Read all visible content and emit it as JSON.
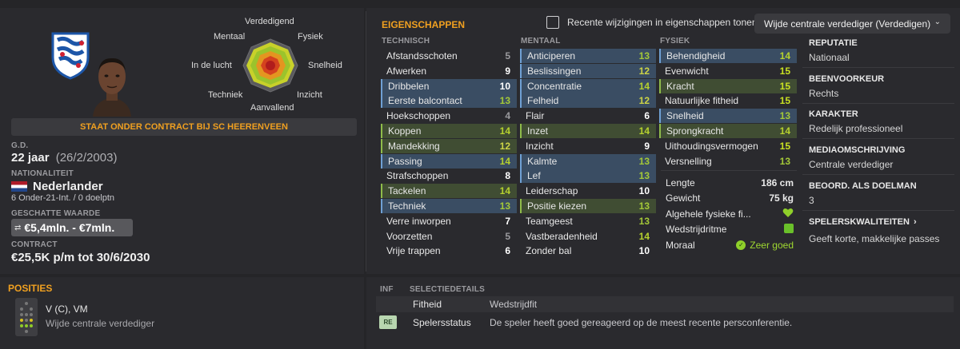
{
  "profile": {
    "contract_banner": "STAAT ONDER CONTRACT BIJ SC HEERENVEEN",
    "dob_label": "G.D.",
    "age": "22 jaar",
    "dob": "(26/2/2003)",
    "nationality_label": "NATIONALITEIT",
    "nationality": "Nederlander",
    "caps": "6 Onder-21-Int. / 0 doelptn",
    "value_label": "GESCHATTE WAARDE",
    "value": "€5,4mln. - €7mln.",
    "contract_label": "CONTRACT",
    "contract": "€25,5K p/m tot 30/6/2030",
    "club_logo_text": "sc Heerenveen"
  },
  "radar": {
    "labels": {
      "top": "Verdedigend",
      "top_left": "Mentaal",
      "top_right": "Fysiek",
      "left": "In de lucht",
      "right": "Snelheid",
      "bottom_left": "Techniek",
      "bottom_right": "Inzicht",
      "bottom": "Aanvallend"
    }
  },
  "attributes": {
    "title": "EIGENSCHAPPEN",
    "toggle_label": "Recente wijzigingen in eigenschappen tonen",
    "role_select": "Wijde centrale verdediger (Verdedigen)",
    "technical_header": "TECHNISCH",
    "mental_header": "MENTAAL",
    "physical_header": "FYSIEK",
    "technical": [
      {
        "name": "Afstandsschoten",
        "value": "5",
        "hl": ""
      },
      {
        "name": "Afwerken",
        "value": "9",
        "hl": ""
      },
      {
        "name": "Dribbelen",
        "value": "10",
        "hl": "blue"
      },
      {
        "name": "Eerste balcontact",
        "value": "13",
        "hl": "blue"
      },
      {
        "name": "Hoekschoppen",
        "value": "4",
        "hl": ""
      },
      {
        "name": "Koppen",
        "value": "14",
        "hl": "green"
      },
      {
        "name": "Mandekking",
        "value": "12",
        "hl": "green"
      },
      {
        "name": "Passing",
        "value": "14",
        "hl": "blue"
      },
      {
        "name": "Strafschoppen",
        "value": "8",
        "hl": ""
      },
      {
        "name": "Tackelen",
        "value": "14",
        "hl": "green"
      },
      {
        "name": "Techniek",
        "value": "13",
        "hl": "blue"
      },
      {
        "name": "Verre inworpen",
        "value": "7",
        "hl": ""
      },
      {
        "name": "Voorzetten",
        "value": "5",
        "hl": ""
      },
      {
        "name": "Vrije trappen",
        "value": "6",
        "hl": ""
      }
    ],
    "mental": [
      {
        "name": "Anticiperen",
        "value": "13",
        "hl": "blue"
      },
      {
        "name": "Beslissingen",
        "value": "12",
        "hl": "blue"
      },
      {
        "name": "Concentratie",
        "value": "14",
        "hl": "blue"
      },
      {
        "name": "Felheid",
        "value": "12",
        "hl": "blue"
      },
      {
        "name": "Flair",
        "value": "6",
        "hl": ""
      },
      {
        "name": "Inzet",
        "value": "14",
        "hl": "green"
      },
      {
        "name": "Inzicht",
        "value": "9",
        "hl": ""
      },
      {
        "name": "Kalmte",
        "value": "13",
        "hl": "blue"
      },
      {
        "name": "Lef",
        "value": "13",
        "hl": "blue"
      },
      {
        "name": "Leiderschap",
        "value": "10",
        "hl": ""
      },
      {
        "name": "Positie kiezen",
        "value": "13",
        "hl": "green"
      },
      {
        "name": "Teamgeest",
        "value": "13",
        "hl": ""
      },
      {
        "name": "Vastberadenheid",
        "value": "14",
        "hl": ""
      },
      {
        "name": "Zonder bal",
        "value": "10",
        "hl": ""
      }
    ],
    "physical": [
      {
        "name": "Behendigheid",
        "value": "14",
        "hl": "blue"
      },
      {
        "name": "Evenwicht",
        "value": "15",
        "hl": ""
      },
      {
        "name": "Kracht",
        "value": "15",
        "hl": "green"
      },
      {
        "name": "Natuurlijke fitheid",
        "value": "15",
        "hl": ""
      },
      {
        "name": "Snelheid",
        "value": "13",
        "hl": "blue"
      },
      {
        "name": "Sprongkracht",
        "value": "14",
        "hl": "green"
      },
      {
        "name": "Uithoudingsvermogen",
        "value": "15",
        "hl": ""
      },
      {
        "name": "Versnelling",
        "value": "13",
        "hl": ""
      }
    ],
    "physical_info": [
      {
        "label": "Lengte",
        "value": "186 cm"
      },
      {
        "label": "Gewicht",
        "value": "75 kg"
      },
      {
        "label": "Algehele fysieke fi...",
        "value": ""
      },
      {
        "label": "Wedstrijdritme",
        "value": ""
      },
      {
        "label": "Moraal",
        "value": "Zeer goed"
      }
    ]
  },
  "right_column": {
    "reputation_title": "REPUTATIE",
    "reputation": "Nationaal",
    "foot_title": "BEENVOORKEUR",
    "foot": "Rechts",
    "character_title": "KARAKTER",
    "character": "Redelijk professioneel",
    "media_title": "MEDIAOMSCHRIJVING",
    "media": "Centrale verdediger",
    "gk_title": "BEOORD. ALS DOELMAN",
    "gk": "3",
    "traits_title": "SPELERSKWALITEITEN",
    "traits": "Geeft korte, makkelijke passes"
  },
  "positions": {
    "title": "POSITIES",
    "positions": "V (C), VM",
    "role": "Wijde centrale verdediger"
  },
  "selection": {
    "inf_header": "INF",
    "details_header": "SELECTIEDETAILS",
    "rows": [
      {
        "badge": "",
        "label": "Fitheid",
        "value": "Wedstrijdfit"
      },
      {
        "badge": "RE",
        "label": "Spelersstatus",
        "value": "De speler heeft goed gereageerd op de meest recente persconferentie."
      }
    ]
  },
  "colors": {
    "accent": "#f0a020",
    "highlight_blue": "#3a4d63",
    "highlight_green": "#404d33"
  }
}
